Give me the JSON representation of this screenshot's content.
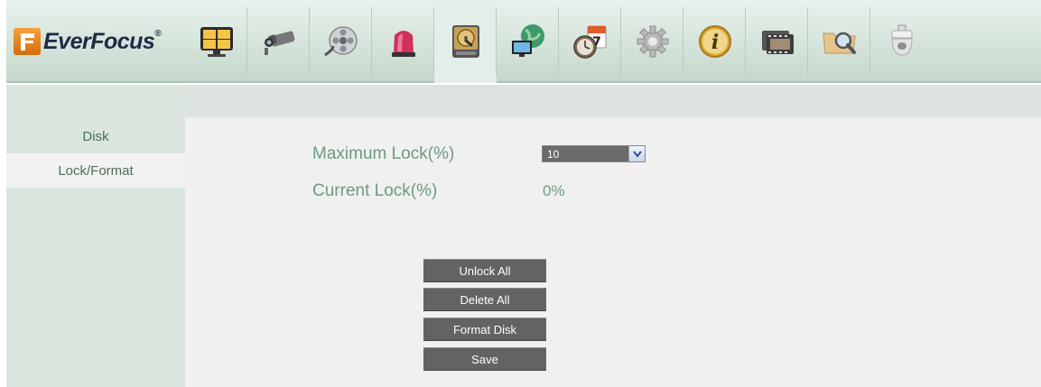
{
  "brand": {
    "name": "EverFocus",
    "registered": "®"
  },
  "nav": {
    "items": [
      {
        "icon": "live-view-grid-icon"
      },
      {
        "icon": "camera-icon"
      },
      {
        "icon": "film-reel-icon"
      },
      {
        "icon": "alarm-siren-icon"
      },
      {
        "icon": "hard-disk-icon"
      },
      {
        "icon": "network-globe-icon"
      },
      {
        "icon": "schedule-clock-calendar-icon",
        "calendar_day": "7"
      },
      {
        "icon": "gear-icon"
      },
      {
        "icon": "info-icon",
        "glyph": "i"
      },
      {
        "icon": "film-strip-icon"
      },
      {
        "icon": "folder-search-icon"
      },
      {
        "icon": "dome-camera-icon"
      }
    ],
    "active_index": 4
  },
  "sidebar": {
    "items": [
      {
        "label": "Disk"
      },
      {
        "label": "Lock/Format"
      }
    ],
    "active": "Lock/Format"
  },
  "main": {
    "max_lock_label": "Maximum Lock(%)",
    "max_lock_value": "10",
    "current_lock_label": "Current Lock(%)",
    "current_lock_value": "0%",
    "buttons": {
      "unlock_all": "Unlock All",
      "delete_all": "Delete All",
      "format_disk": "Format Disk",
      "save": "Save"
    }
  },
  "colors": {
    "header_bg": "#d5e4da",
    "sidebar_bg": "#d9e5dd",
    "main_bg": "#f0f0f0",
    "label_text": "#6e9a7e",
    "button_bg": "#636363",
    "logo_orange": "#e8821f"
  }
}
